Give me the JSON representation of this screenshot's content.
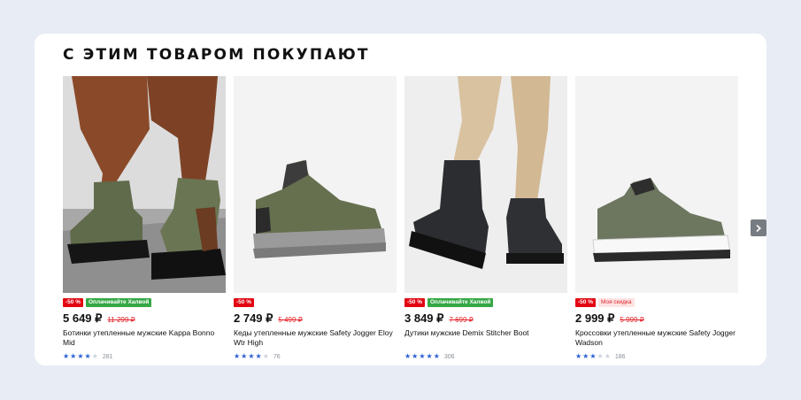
{
  "section": {
    "title": "С ЭТИМ ТОВАРОМ ПОКУПАЮТ"
  },
  "products": [
    {
      "badges": [
        "-50 %",
        "Оплачивайте Халвой"
      ],
      "badge_types": [
        "disc",
        "halva"
      ],
      "price": "5 649 ₽",
      "old_price": "11 299 ₽",
      "name": "Ботинки утепленные мужские Kappa Bonno Mid",
      "rating": 3.5,
      "reviews": "281",
      "image_icon": "olive-boot-on-legs"
    },
    {
      "badges": [
        "-50 %"
      ],
      "badge_types": [
        "disc"
      ],
      "price": "2 749 ₽",
      "old_price": "5 499 ₽",
      "name": "Кеды утепленные мужские Safety Jogger Eloy Wtr High",
      "rating": 3.5,
      "reviews": "76",
      "image_icon": "olive-high-sneaker"
    },
    {
      "badges": [
        "-50 %",
        "Оплачивайте Халвой"
      ],
      "badge_types": [
        "disc",
        "halva"
      ],
      "price": "3 849 ₽",
      "old_price": "7 699 ₽",
      "name": "Дутики мужские Demix Stitcher Boot",
      "rating": 4.5,
      "reviews": "306",
      "image_icon": "black-puffer-boot-on-legs"
    },
    {
      "badges": [
        "-50 %",
        "Моя скидка"
      ],
      "badge_types": [
        "disc",
        "mine"
      ],
      "price": "2 999 ₽",
      "old_price": "5 999 ₽",
      "name": "Кроссовки утепленные мужские Safety Jogger Wadson",
      "rating": 2.5,
      "reviews": "186",
      "image_icon": "olive-white-sneaker"
    }
  ],
  "carousel": {
    "next_icon": "chevron-right-icon",
    "next_symbol": "›"
  },
  "colors": {
    "discount": "#e30613",
    "halva": "#35a845",
    "star": "#2b60d6",
    "old_price": "#e3242b"
  }
}
